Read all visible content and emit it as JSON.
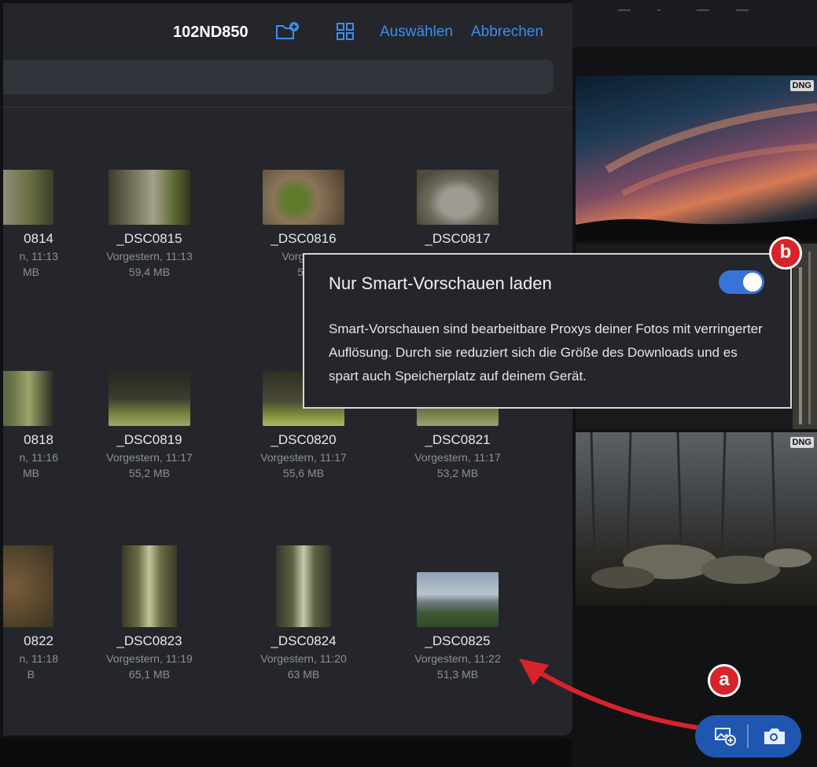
{
  "header": {
    "folder_name": "102ND850",
    "select_label": "Auswählen",
    "cancel_label": "Abbrechen"
  },
  "files": [
    {
      "name": "0814",
      "date": "n, 11:13",
      "size": "MB"
    },
    {
      "name": "_DSC0815",
      "date": "Vorgestern, 11:13",
      "size": "59,4 MB"
    },
    {
      "name": "_DSC0816",
      "date": "Vorgeste",
      "size": "58"
    },
    {
      "name": "_DSC0817",
      "date": "",
      "size": ""
    },
    {
      "name": "0818",
      "date": "n, 11:16",
      "size": "MB"
    },
    {
      "name": "_DSC0819",
      "date": "Vorgestern, 11:17",
      "size": "55,2 MB"
    },
    {
      "name": "_DSC0820",
      "date": "Vorgestern, 11:17",
      "size": "55,6 MB"
    },
    {
      "name": "_DSC0821",
      "date": "Vorgestern, 11:17",
      "size": "53,2 MB"
    },
    {
      "name": "0822",
      "date": "n, 11:18",
      "size": "B"
    },
    {
      "name": "_DSC0823",
      "date": "Vorgestern, 11:19",
      "size": "65,1 MB"
    },
    {
      "name": "_DSC0824",
      "date": "Vorgestern, 11:20",
      "size": "63 MB"
    },
    {
      "name": "_DSC0825",
      "date": "Vorgestern, 11:22",
      "size": "51,3 MB"
    }
  ],
  "popover": {
    "title": "Nur Smart-Vorschauen laden",
    "toggle_on": true,
    "description": "Smart-Vorschauen sind bearbeitbare Proxys deiner Fotos mit verringerter Auflösung. Durch sie reduziert sich die Größe des Downloads und es spart auch Speicherplatz auf deinem Gerät."
  },
  "badges": {
    "a": "a",
    "b": "b"
  },
  "right_photos": {
    "badge": "DNG"
  },
  "colors": {
    "accent": "#3b8ff0",
    "toggle": "#3a73d8",
    "callout": "#d8232a",
    "fab": "#1f56b0"
  },
  "icons": {
    "new_folder": "folder-plus-icon",
    "grid": "grid-icon",
    "import": "image-plus-icon",
    "camera": "camera-icon"
  }
}
